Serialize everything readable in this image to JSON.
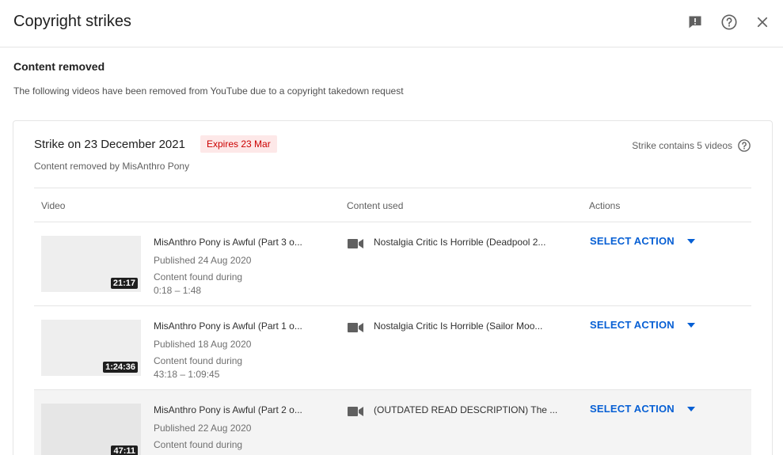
{
  "header": {
    "title": "Copyright strikes"
  },
  "section": {
    "title": "Content removed",
    "description": "The following videos have been removed from YouTube due to a copyright takedown request"
  },
  "strike": {
    "title": "Strike on 23 December 2021",
    "expires": "Expires 23 Mar",
    "removed_by": "Content removed by MisAnthro Pony",
    "contains": "Strike contains 5 videos"
  },
  "table": {
    "headers": {
      "video": "Video",
      "content_used": "Content used",
      "actions": "Actions"
    },
    "rows": [
      {
        "duration": "21:17",
        "title": "MisAnthro Pony is Awful (Part 3 o...",
        "published": "Published 24 Aug 2020",
        "found_label": "Content found during",
        "found_range": "0:18 – 1:48",
        "content_used": "Nostalgia Critic Is Horrible (Deadpool 2...",
        "action": "SELECT ACTION"
      },
      {
        "duration": "1:24:36",
        "title": "MisAnthro Pony is Awful (Part 1 o...",
        "published": "Published 18 Aug 2020",
        "found_label": "Content found during",
        "found_range": "43:18 – 1:09:45",
        "content_used": "Nostalgia Critic Is Horrible (Sailor Moo...",
        "action": "SELECT ACTION"
      },
      {
        "duration": "47:11",
        "title": "MisAnthro Pony is Awful (Part 2 o...",
        "published": "Published 22 Aug 2020",
        "found_label": "Content found during",
        "found_range": "",
        "content_used": "(OUTDATED READ DESCRIPTION) The ...",
        "action": "SELECT ACTION"
      }
    ]
  },
  "icons": {
    "feedback": "feedback-icon",
    "help": "help-icon",
    "close": "close-icon",
    "camera": "video-camera-icon",
    "dropdown": "caret-down-icon"
  },
  "colors": {
    "accent": "#065fd4",
    "badge_bg": "#fde8e8",
    "badge_text": "#cc0000"
  }
}
